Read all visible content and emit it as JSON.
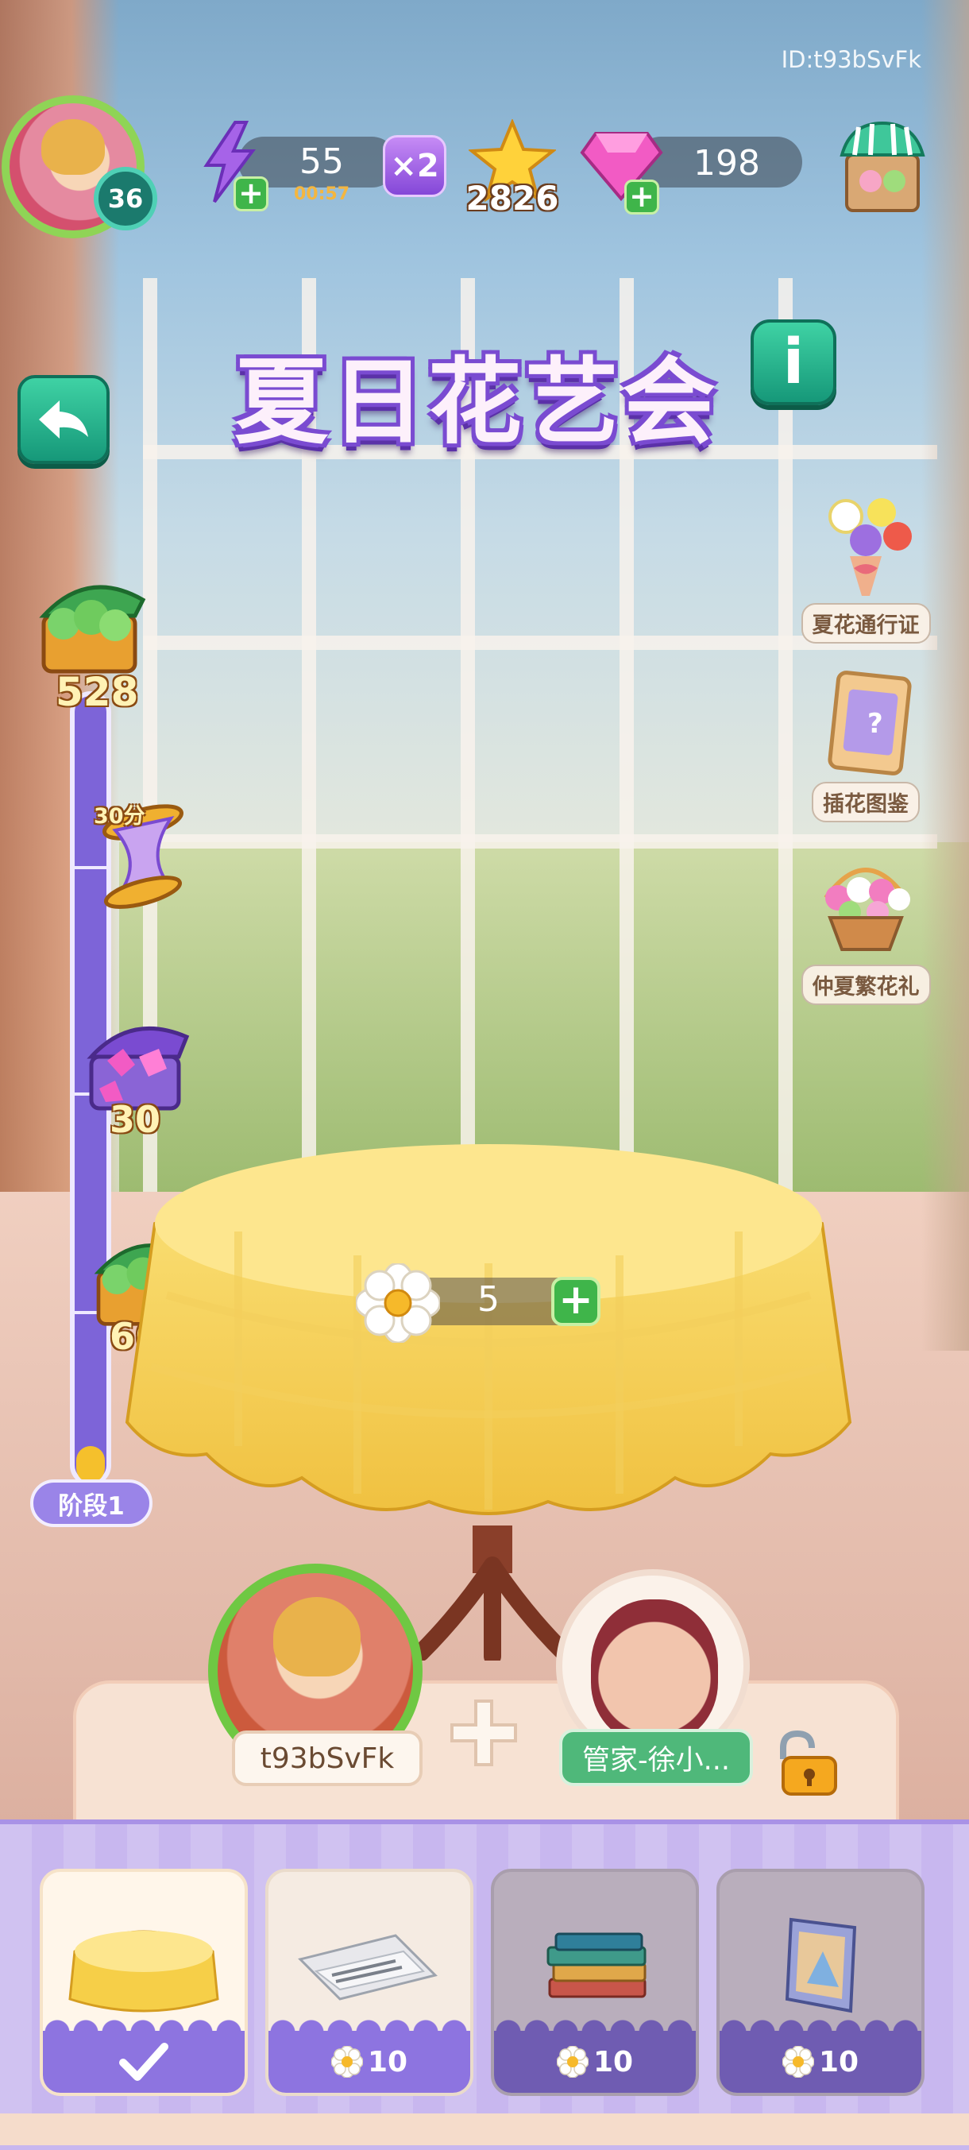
{
  "header": {
    "user_id": "ID:t93bSvFk",
    "level": "36",
    "energy_value": "55",
    "energy_timer": "00:57",
    "multiplier": "×2",
    "stars": "2826",
    "gems": "198"
  },
  "event": {
    "title": "夏日花艺会"
  },
  "side_menu": [
    {
      "label": "夏花通行证",
      "icon": "flower-bouquet-icon"
    },
    {
      "label": "插花图鉴",
      "icon": "album-card-icon"
    },
    {
      "label": "仲夏繁花礼",
      "icon": "flower-basket-icon"
    }
  ],
  "progress": {
    "rewards": [
      {
        "type": "cash-chest",
        "amount": "528"
      },
      {
        "type": "hourglass",
        "amount": "30分"
      },
      {
        "type": "gem-chest",
        "amount": "30"
      },
      {
        "type": "cash-chest",
        "amount": "66"
      }
    ],
    "stage": "阶段1",
    "fill": 0.04
  },
  "flowers": {
    "count": "5"
  },
  "team": {
    "player_name": "t93bSvFk",
    "partner_name": "管家-徐小..."
  },
  "items": [
    {
      "name": "tablecloth",
      "state": "selected",
      "cost": ""
    },
    {
      "name": "newspaper",
      "state": "available",
      "cost": "10"
    },
    {
      "name": "books",
      "state": "locked",
      "cost": "10"
    },
    {
      "name": "photo-frame",
      "state": "locked",
      "cost": "10"
    }
  ],
  "colors": {
    "accent_purple": "#7a4bd1",
    "button_teal": "#169879",
    "add_green": "#3fb54a"
  }
}
